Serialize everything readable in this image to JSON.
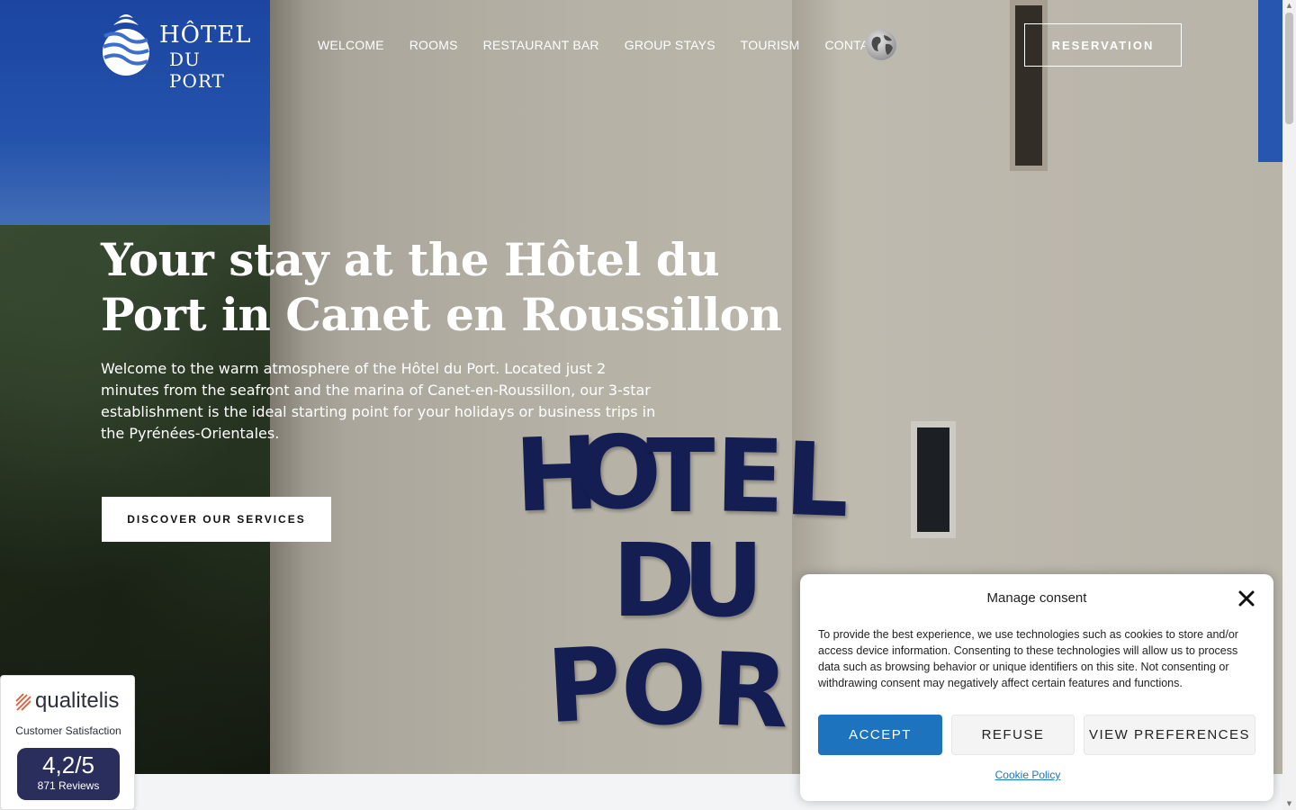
{
  "header": {
    "logo_line1": "HÔTEL",
    "logo_line2": "DU PORT",
    "nav": [
      {
        "label": "WELCOME",
        "active": true
      },
      {
        "label": "ROOMS"
      },
      {
        "label": "RESTAURANT BAR"
      },
      {
        "label": "GROUP STAYS"
      },
      {
        "label": "TOURISM"
      },
      {
        "label": "CONTACT"
      }
    ],
    "language_icon": "globe-icon",
    "reservation_label": "RESERVATION"
  },
  "hero": {
    "title": "Your stay at the Hôtel du Port in Canet en Roussillon",
    "text": "Welcome to the warm atmosphere of the Hôtel du Port. Located just 2 minutes from the seafront and the marina of Canet-en-Roussillon, our 3-star establishment is the ideal starting point for your holidays or business trips in the Pyrénées-Orientales.",
    "cta_label": "DISCOVER OUR SERVICES",
    "sign_letters": [
      "H",
      "O",
      "T",
      "E",
      "L",
      "D",
      "U",
      "P",
      "O",
      "R"
    ]
  },
  "rating_widget": {
    "brand": "qualitelis",
    "subtitle": "Customer Satisfaction",
    "score": "4,2/5",
    "reviews": "871 Reviews"
  },
  "consent": {
    "title": "Manage consent",
    "text": "To provide the best experience, we use technologies such as cookies to store and/or access device information. Consenting to these technologies will allow us to process data such as browsing behavior or unique identifiers on this site. Not consenting or withdrawing consent may negatively affect certain features and functions.",
    "accept_label": "ACCEPT",
    "refuse_label": "REFUSE",
    "preferences_label": "VIEW PREFERENCES",
    "policy_link": "Cookie Policy"
  },
  "colors": {
    "accent": "#1e73be",
    "score_box": "#2a2e5c",
    "sign_text": "#17235e"
  }
}
